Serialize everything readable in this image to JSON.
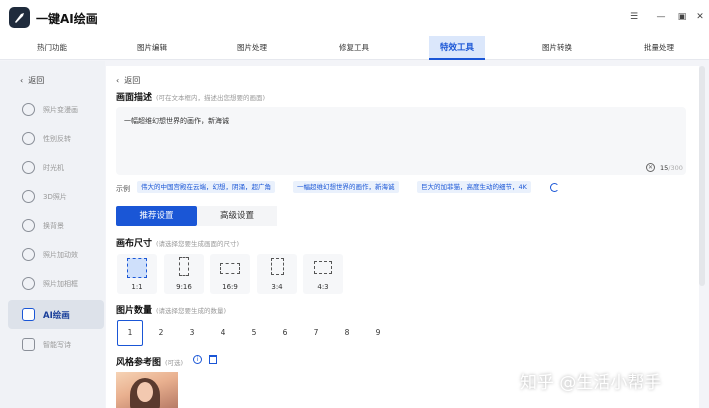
{
  "app": {
    "title": "一键AI绘画",
    "logo_icon": "brush-icon",
    "window_controls": [
      "menu-icon",
      "minimize-icon",
      "maximize-icon",
      "close-icon"
    ]
  },
  "tabs": [
    {
      "label": "热门功能"
    },
    {
      "label": "图片编辑"
    },
    {
      "label": "图片处理"
    },
    {
      "label": "修复工具"
    },
    {
      "label": "特效工具",
      "active": true
    },
    {
      "label": "图片转换"
    },
    {
      "label": "批量处理"
    }
  ],
  "sidebar": {
    "back_label": "返回",
    "items": [
      {
        "label": "照片变漫画",
        "icon": "cartoon-icon"
      },
      {
        "label": "性别反转",
        "icon": "gender-icon"
      },
      {
        "label": "时光机",
        "icon": "clock-icon"
      },
      {
        "label": "3D照片",
        "icon": "cube-icon"
      },
      {
        "label": "换背景",
        "icon": "background-icon"
      },
      {
        "label": "照片加动效",
        "icon": "motion-icon"
      },
      {
        "label": "照片加相框",
        "icon": "frame-icon"
      },
      {
        "label": "AI绘画",
        "icon": "ai-icon",
        "active": true
      },
      {
        "label": "智能写诗",
        "icon": "ai-poem-icon"
      }
    ]
  },
  "main": {
    "back_label": "返回",
    "description": {
      "title": "画面描述",
      "hint": "(可在文本框内，描述出您想要的画面)",
      "value": "一幅超维幻想世界的画作，新海诚",
      "count": "15",
      "max": "/300"
    },
    "examples": {
      "label": "示例",
      "chips": [
        "伟大的中国宫殿在云端，幻想，阴涌，超广角",
        "一幅超维幻想世界的画作，新海诚",
        "巨大的加菲猫，高度生动的细节，4K"
      ]
    },
    "settings_tabs": {
      "recommended": "推荐设置",
      "advanced": "高级设置"
    },
    "canvas_size": {
      "title": "画布尺寸",
      "hint": "(请选择您要生成画面的尺寸)",
      "options": [
        "1:1",
        "9:16",
        "16:9",
        "3:4",
        "4:3"
      ],
      "selected": "1:1"
    },
    "image_count": {
      "title": "图片数量",
      "hint": "(请选择您要生成的数量)",
      "options": [
        "1",
        "2",
        "3",
        "4",
        "5",
        "6",
        "7",
        "8",
        "9"
      ],
      "selected": "1"
    },
    "style_ref": {
      "title": "风格参考图",
      "hint": "(可选)"
    }
  },
  "watermark": "知乎 @生活小帮手",
  "colors": {
    "accent": "#1a56d6",
    "chip_bg": "#eaf1fc",
    "active_tab_bg": "#dbe7fb"
  }
}
